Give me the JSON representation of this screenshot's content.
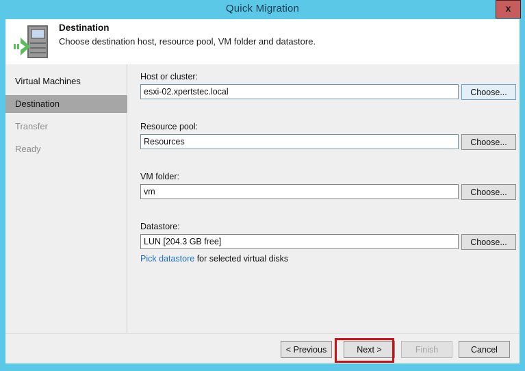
{
  "window": {
    "title": "Quick Migration",
    "close_label": "x",
    "titlebar_color": "#5bc8e8",
    "close_color": "#c75c5c"
  },
  "header": {
    "icon": "server-migrate-icon",
    "title": "Destination",
    "subtitle": "Choose destination host, resource pool, VM folder and datastore."
  },
  "sidebar": {
    "items": [
      {
        "label": "Virtual Machines",
        "state": "enabled"
      },
      {
        "label": "Destination",
        "state": "active"
      },
      {
        "label": "Transfer",
        "state": "disabled"
      },
      {
        "label": "Ready",
        "state": "disabled"
      }
    ]
  },
  "form": {
    "fields": [
      {
        "label": "Host or cluster:",
        "value": "esxi-02.xpertstec.local",
        "placeholder": "",
        "button": "Choose...",
        "button_state": "hover"
      },
      {
        "label": "Resource pool:",
        "value": "Resources",
        "placeholder": "",
        "button": "Choose...",
        "button_state": "normal"
      },
      {
        "label": "VM folder:",
        "value": "vm",
        "placeholder": "",
        "button": "Choose...",
        "button_state": "normal"
      },
      {
        "label": "Datastore:",
        "value": "LUN [204.3 GB free]",
        "placeholder": "",
        "button": "Choose...",
        "button_state": "normal"
      }
    ],
    "pick_link": "Pick datastore",
    "pick_tail": " for selected virtual disks",
    "link_color": "#1f6fc4"
  },
  "footer": {
    "previous_label": "< Previous",
    "next_label": "Next >",
    "finish_label": "Finish",
    "cancel_label": "Cancel",
    "finish_disabled": true,
    "highlight_color": "#cc1111",
    "highlight_target": "Next >"
  }
}
